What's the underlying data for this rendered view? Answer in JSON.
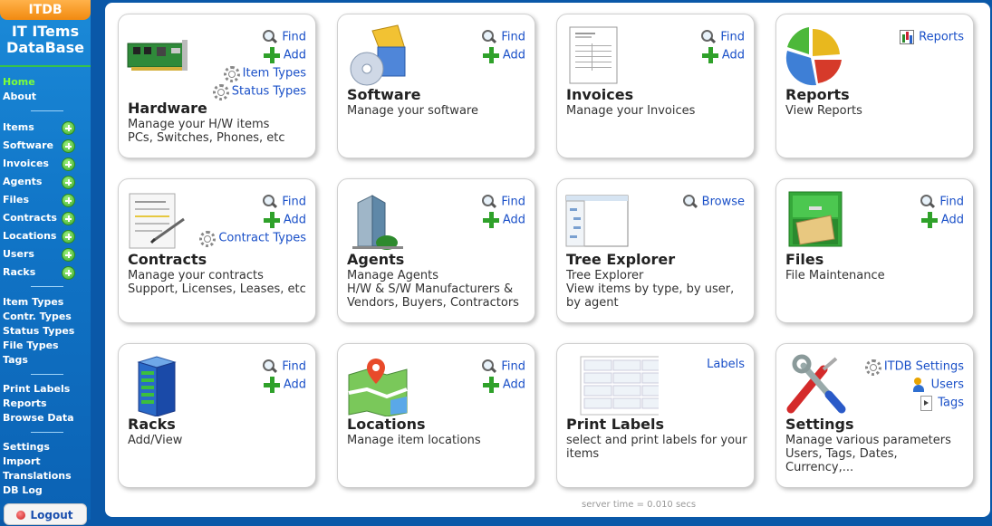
{
  "sidebar": {
    "brand_tab": "ITDB",
    "brand_title_line1": "IT ITems",
    "brand_title_line2": "DataBase",
    "top_links": [
      "Home",
      "About"
    ],
    "add_links": [
      "Items",
      "Software",
      "Invoices",
      "Agents",
      "Files",
      "Contracts",
      "Locations",
      "Users",
      "Racks"
    ],
    "type_links": [
      "Item Types",
      "Contr. Types",
      "Status Types",
      "File Types",
      "Tags"
    ],
    "report_links": [
      "Print Labels",
      "Reports",
      "Browse Data"
    ],
    "admin_links": [
      "Settings",
      "Import",
      "Translations",
      "DB Log"
    ],
    "logout": "Logout"
  },
  "cards": {
    "hardware": {
      "title": "Hardware",
      "desc1": "Manage your H/W items",
      "desc2": "PCs, Switches, Phones, etc",
      "links": [
        "Find",
        "Add",
        "Item Types",
        "Status Types"
      ]
    },
    "software": {
      "title": "Software",
      "desc1": "Manage your software",
      "links": [
        "Find",
        "Add"
      ]
    },
    "invoices": {
      "title": "Invoices",
      "desc1": "Manage your Invoices",
      "links": [
        "Find",
        "Add"
      ]
    },
    "reports": {
      "title": "Reports",
      "desc1": "View Reports",
      "links": [
        "Reports"
      ]
    },
    "contracts": {
      "title": "Contracts",
      "desc1": "Manage your contracts",
      "desc2": "Support, Licenses, Leases, etc",
      "links": [
        "Find",
        "Add",
        "Contract Types"
      ]
    },
    "agents": {
      "title": "Agents",
      "desc1": "Manage Agents",
      "desc2": "H/W & S/W Manufacturers & Vendors, Buyers, Contractors",
      "links": [
        "Find",
        "Add"
      ]
    },
    "tree": {
      "title": "Tree Explorer",
      "desc1": "Tree Explorer",
      "desc2": "View items by type, by user, by agent",
      "links": [
        "Browse"
      ]
    },
    "files": {
      "title": "Files",
      "desc1": "File Maintenance",
      "links": [
        "Find",
        "Add"
      ]
    },
    "racks": {
      "title": "Racks",
      "desc1": "Add/View",
      "links": [
        "Find",
        "Add"
      ]
    },
    "locations": {
      "title": "Locations",
      "desc1": "Manage item locations",
      "links": [
        "Find",
        "Add"
      ]
    },
    "labels": {
      "title": "Print Labels",
      "desc1": "select and print labels for your items",
      "links": [
        "Labels"
      ]
    },
    "settings": {
      "title": "Settings",
      "desc1": "Manage various parameters",
      "desc2": "Users, Tags, Dates, Currency,...",
      "links": [
        "ITDB Settings",
        "Users",
        "Tags"
      ]
    }
  },
  "footer": {
    "server_time": "server time = 0.010 secs"
  }
}
